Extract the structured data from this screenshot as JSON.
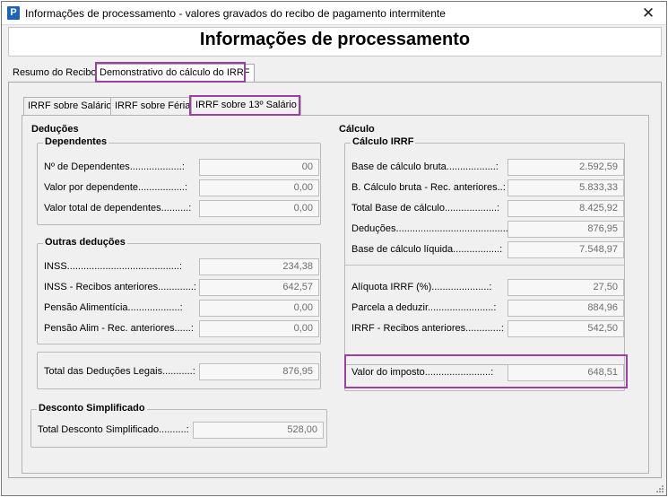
{
  "window": {
    "title": "Informações de processamento - valores gravados do recibo de pagamento intermitente",
    "app_icon": "P",
    "close": "✕"
  },
  "page_title": "Informações de processamento",
  "outer_tabs": [
    {
      "label": "Resumo do Recibo",
      "active": false
    },
    {
      "label": "Demonstrativo do cálculo do IRRF",
      "active": true
    }
  ],
  "inner_tabs": [
    {
      "label": "IRRF sobre Salário",
      "active": false
    },
    {
      "label": "IRRF sobre Férias",
      "active": false
    },
    {
      "label": "IRRF sobre 13º Salário",
      "active": true
    }
  ],
  "deducoes": {
    "title": "Deduções",
    "dependentes": {
      "title": "Dependentes",
      "rows": [
        {
          "label": "Nº de Dependentes...................:",
          "value": "00"
        },
        {
          "label": "Valor por dependente.................:",
          "value": "0,00"
        },
        {
          "label": "Valor total de dependentes..........:",
          "value": "0,00"
        }
      ]
    },
    "outras": {
      "title": "Outras deduções",
      "rows": [
        {
          "label": "INSS.........................................:",
          "value": "234,38"
        },
        {
          "label": "INSS - Recibos anteriores.............:",
          "value": "642,57"
        },
        {
          "label": "Pensão Alimentícia...................:",
          "value": "0,00"
        },
        {
          "label": "Pensão Alim - Rec. anteriores......:",
          "value": "0,00"
        }
      ]
    },
    "total_legais": {
      "label": "Total das Deduções Legais...........:",
      "value": "876,95"
    }
  },
  "desconto_simplificado": {
    "title": "Desconto Simplificado",
    "label": "Total Desconto Simplificado..........:",
    "value": "528,00"
  },
  "calculo": {
    "title": "Cálculo",
    "irrf": {
      "title": "Cálculo IRRF",
      "rows_top": [
        {
          "label": "Base de cálculo bruta..................:",
          "value": "2.592,59"
        },
        {
          "label": "B. Cálculo bruta - Rec. anteriores..:",
          "value": "5.833,33"
        },
        {
          "label": "Total Base de cálculo...................:",
          "value": "8.425,92"
        },
        {
          "label": "Deduções..........................................:",
          "value": "876,95"
        },
        {
          "label": "Base de cálculo líquida.................:",
          "value": "7.548,97"
        }
      ],
      "rows_bottom": [
        {
          "label": "Alíquota IRRF (%).....................:",
          "value": "27,50"
        },
        {
          "label": "Parcela a deduzir........................:",
          "value": "884,96"
        },
        {
          "label": "IRRF - Recibos anteriores.............:",
          "value": "542,50"
        }
      ]
    },
    "imposto": {
      "label": "Valor do imposto........................:",
      "value": "648,51"
    }
  },
  "colors": {
    "highlight": "#9b3fa3",
    "app_icon": "#1d63b8"
  }
}
